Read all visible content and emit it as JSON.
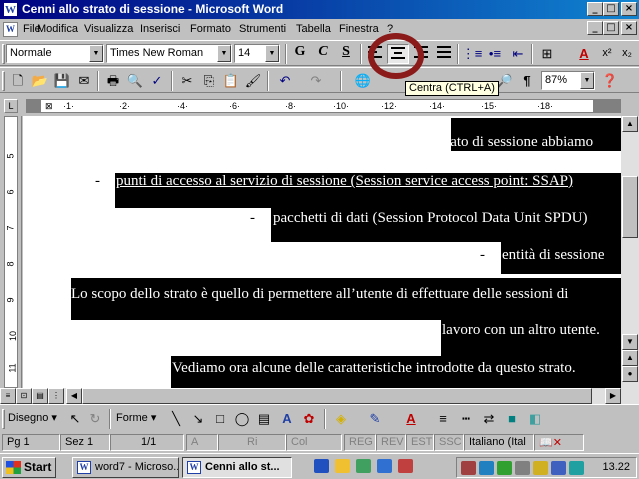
{
  "window": {
    "title": "Cenni allo strato di sessione - Microsoft Word",
    "controls": {
      "minimize": "_",
      "maximize": "□",
      "close": "×"
    }
  },
  "menu": {
    "items": [
      "File",
      "Modifica",
      "Visualizza",
      "Inserisci",
      "Formato",
      "Strumenti",
      "Tabella",
      "Finestra",
      "?"
    ]
  },
  "formatting": {
    "style": "Normale",
    "font": "Times New Roman",
    "size": "14",
    "bold": "G",
    "italic": "C",
    "underline": "S"
  },
  "standard": {
    "zoom": "87%"
  },
  "tooltip": "Centra (CTRL+A)",
  "document": {
    "lines": [
      "Anche per lo strato di sessione abbiamo",
      "-",
      "punti di accesso al servizio di sessione (Session service access point: SSAP)",
      "-",
      "pacchetti di dati (Session Protocol Data Unit SPDU)",
      "-",
      "entità di sessione",
      "Lo scopo dello strato è quello di permettere all’utente di effettuare delle sessioni di",
      "lavoro con un altro utente.",
      "Vediamo ora alcune delle caratteristiche introdotte da questo strato."
    ]
  },
  "drawing": {
    "disegno": "Disegno",
    "forme": "Forme"
  },
  "status": {
    "page": "Pg 1",
    "section": "Sez 1",
    "pages": "1/1",
    "at": "A",
    "line": "Ri",
    "col": "Col",
    "reg": "REG",
    "rev": "REV",
    "est": "EST",
    "ssc": "SSC",
    "language": "Italiano (Ital"
  },
  "taskbar": {
    "start": "Start",
    "tasks": [
      "word7 - Microso...",
      "Cenni allo st..."
    ],
    "clock": "13.22"
  },
  "colors": {
    "title_start": "#000080",
    "title_end": "#1084d0",
    "highlight_circle": "#8b1a1a",
    "selection": "#000000"
  }
}
